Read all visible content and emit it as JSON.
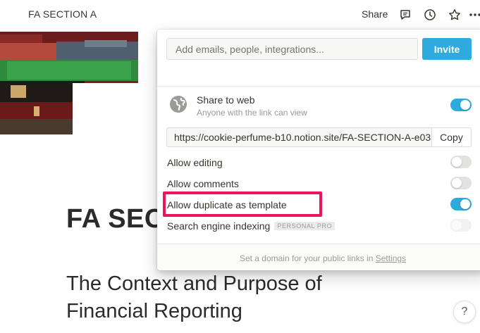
{
  "topbar": {
    "breadcrumb": "FA SECTION A",
    "share_label": "Share"
  },
  "page": {
    "title": "FA SECTION A",
    "title_visible": "FA SECT",
    "heading": "The Context and Purpose of Financial Reporting"
  },
  "help": {
    "label": "?"
  },
  "share_popover": {
    "invite_placeholder": "Add emails, people, integrations...",
    "invite_button": "Invite",
    "share_to_web": {
      "title": "Share to web",
      "subtitle": "Anyone with the link can view",
      "enabled": true
    },
    "public_url": "https://cookie-perfume-b10.notion.site/FA-SECTION-A-e03",
    "copy_button": "Copy",
    "options": [
      {
        "label": "Allow editing",
        "enabled": false
      },
      {
        "label": "Allow comments",
        "enabled": false
      },
      {
        "label": "Allow duplicate as template",
        "enabled": true
      },
      {
        "label": "Search engine indexing",
        "badge": "PERSONAL PRO",
        "enabled": false,
        "disabled": true
      }
    ],
    "footer_text": "Set a domain for your public links in ",
    "footer_link": "Settings"
  },
  "colors": {
    "accent": "#2eaadc",
    "highlight": "#e8175d"
  }
}
